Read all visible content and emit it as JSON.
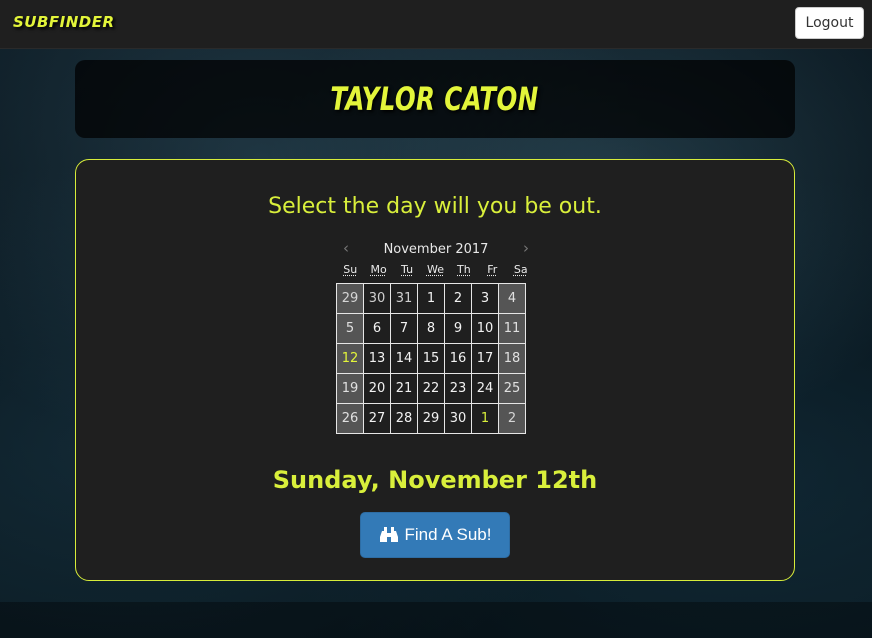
{
  "navbar": {
    "brand": "SUBFINDER",
    "logout_label": "Logout"
  },
  "profile": {
    "name": "TAYLOR CATON"
  },
  "main": {
    "prompt": "Select the day will you be out.",
    "calendar": {
      "month_title": "November 2017",
      "prev_icon": "chevron-left-icon",
      "next_icon": "chevron-right-icon",
      "weekdays": [
        "Su",
        "Mo",
        "Tu",
        "We",
        "Th",
        "Fr",
        "Sa"
      ],
      "weeks": [
        [
          "29",
          "30",
          "31",
          "1",
          "2",
          "3",
          "4"
        ],
        [
          "5",
          "6",
          "7",
          "8",
          "9",
          "10",
          "11"
        ],
        [
          "12",
          "13",
          "14",
          "15",
          "16",
          "17",
          "18"
        ],
        [
          "19",
          "20",
          "21",
          "22",
          "23",
          "24",
          "25"
        ],
        [
          "26",
          "27",
          "28",
          "29",
          "30",
          "1",
          "2"
        ]
      ],
      "selected_day": "12"
    },
    "selected_date_text": "Sunday, November 12th",
    "find_button": {
      "label": "Find A Sub!",
      "icon": "binoculars-icon"
    }
  },
  "colors": {
    "accent": "#d9ef3b",
    "button_primary": "#337ab7",
    "weekend_cell": "#555555"
  }
}
